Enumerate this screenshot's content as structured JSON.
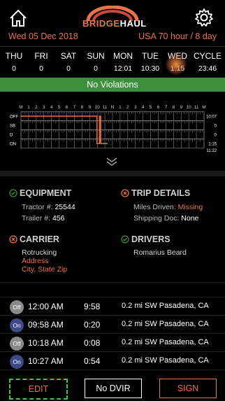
{
  "header": {
    "brand_part1": "BRIDGE",
    "brand_part2": "HAUL",
    "date_label": "Wed 05 Dec 2018",
    "cycle_rule": "USA 70 hour / 8 day"
  },
  "days": [
    {
      "name": "THU",
      "value": "0"
    },
    {
      "name": "FRI",
      "value": "0"
    },
    {
      "name": "SAT",
      "value": "0"
    },
    {
      "name": "SUN",
      "value": "0"
    },
    {
      "name": "MON",
      "value": "12:01"
    },
    {
      "name": "TUE",
      "value": "10:30"
    },
    {
      "name": "WED",
      "value": "1:15"
    },
    {
      "name": "CYCLE",
      "value": "23:46"
    }
  ],
  "status_bar": "No Violations",
  "chart": {
    "row_labels": [
      "OFF",
      "SB",
      "D",
      "ON"
    ],
    "row_totals": [
      "10:07",
      "0",
      "0",
      "1:15"
    ],
    "total": "11:22",
    "hour_labels": [
      "M",
      "1",
      "2",
      "3",
      "4",
      "5",
      "6",
      "7",
      "8",
      "9",
      "10",
      "11",
      "N",
      "1",
      "2",
      "3",
      "4",
      "5",
      "6",
      "7",
      "8",
      "9",
      "10",
      "11",
      "M"
    ],
    "accent_color": "#e8734a",
    "grid_color": "#8a8a8a"
  },
  "equipment": {
    "title": "EQUIPMENT",
    "tractor_label": "Tractor #:",
    "tractor_value": "25544",
    "trailer_label": "Trailer #:",
    "trailer_value": "456"
  },
  "trip_details": {
    "title": "TRIP DETAILS",
    "miles_label": "Miles Driven:",
    "miles_value": "Missing",
    "shipping_label": "Shipping Doc:",
    "shipping_value": "None"
  },
  "carrier": {
    "title": "CARRIER",
    "name": "Rotrucking",
    "address": "Address",
    "city": "City, State Zip"
  },
  "drivers": {
    "title": "DRIVERS",
    "name": "Romarius Beard"
  },
  "logs": [
    {
      "status": "Off",
      "time": "12:00 AM",
      "duration": "9:58",
      "location": "0.2 mi SW Pasadena, CA"
    },
    {
      "status": "On",
      "time": "09:58 AM",
      "duration": "0:20",
      "location": "0.2 mi SW Pasadena, CA"
    },
    {
      "status": "Off",
      "time": "10:18 AM",
      "duration": "0:08",
      "location": "0.2 mi SW Pasadena, CA"
    },
    {
      "status": "On",
      "time": "10:27 AM",
      "duration": "0:54",
      "location": "0.2 mi SW Pasadena, CA"
    }
  ],
  "footer": {
    "edit": "EDIT",
    "no_dvir": "No DVIR",
    "sign": "SIGN"
  },
  "colors": {
    "accent": "#e8734a",
    "ok_green": "#3d8f3d",
    "on_blue": "#3e4a8a",
    "off_gray": "#8a8a8a"
  }
}
